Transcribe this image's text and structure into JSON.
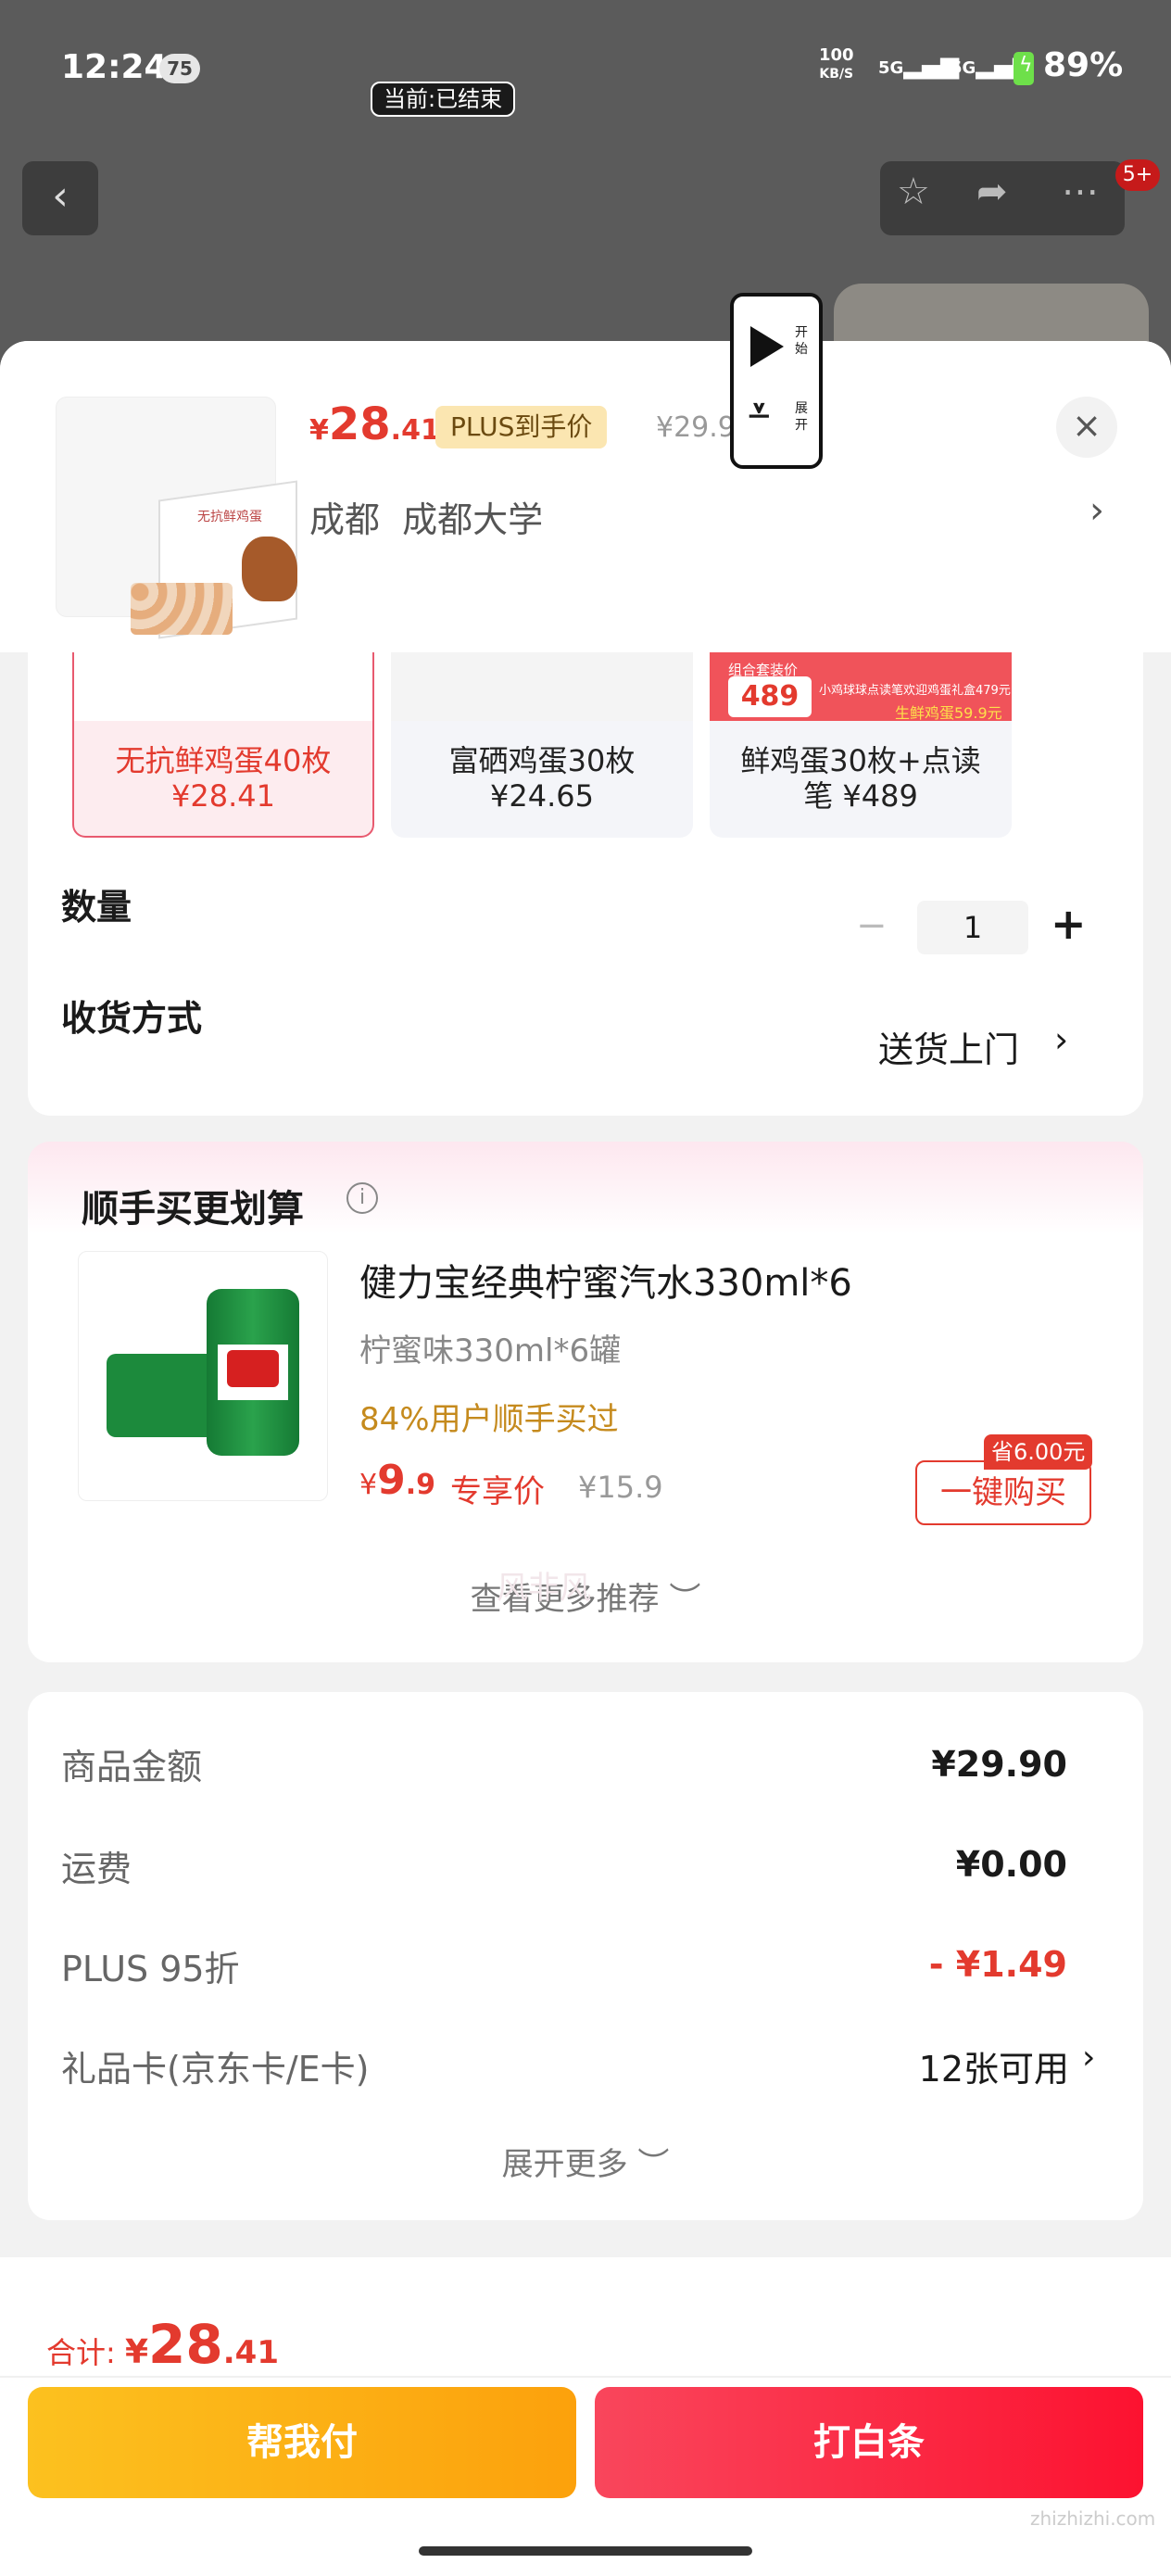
{
  "status_bar": {
    "time": "12:24",
    "notif_count": "75",
    "net_speed": "100",
    "net_unit": "KB/S",
    "signal1": "5G",
    "signal2": "5G",
    "battery": "89%"
  },
  "recording": {
    "label": "当前:已结束"
  },
  "top_nav": {
    "msg_badge": "5+"
  },
  "product": {
    "price_currency": "¥",
    "price_int": "28",
    "price_dec": ".41",
    "plus_tag": "PLUS到手价",
    "orig_price": "¥29.9",
    "thumb_title": "无抗鲜鸡蛋",
    "address": "成都  成都大学"
  },
  "floating_control": {
    "start_label": "开始",
    "collapse_label": "展开"
  },
  "spec_options": [
    {
      "label": "无抗鲜鸡蛋40枚\n¥28.41",
      "selected": true
    },
    {
      "label": "富硒鸡蛋30枚\n¥24.65",
      "selected": false
    },
    {
      "label": "鲜鸡蛋30枚+点读\n笔 ¥489",
      "selected": false,
      "promo_price": "489",
      "promo_line1": "组合套装价",
      "promo_line2": "生鲜鸡蛋59.9元",
      "promo_line3": "小鸡球球点读笔欢迎鸡蛋礼盒479元"
    }
  ],
  "quantity": {
    "label": "数量",
    "minus": "−",
    "value": "1",
    "plus": "+"
  },
  "delivery": {
    "label": "收货方式",
    "value": "送货上门"
  },
  "addon": {
    "title": "顺手买更划算",
    "name": "健力宝经典柠蜜汽水330ml*6",
    "spec": "柠蜜味330ml*6罐",
    "percent_text": "84%用户顺手买过",
    "price_currency": "¥",
    "price_int": "9",
    "price_dec": ".9",
    "exclusive": "专享价",
    "orig_price": "¥15.9",
    "save_tag": "省6.00元",
    "buy_label": "一键购买",
    "more_label": "查看更多推荐 ︶",
    "watermark": "风非风"
  },
  "summary": {
    "rows": [
      {
        "label": "商品金额",
        "value": "¥29.90"
      },
      {
        "label": "运费",
        "value": "¥0.00"
      },
      {
        "label": "PLUS 95折",
        "value": "- ¥1.49"
      },
      {
        "label": "礼品卡(京东卡/E卡)",
        "value": "12张可用"
      }
    ],
    "expand_label": "展开更多 ︶"
  },
  "bottom_bar": {
    "total_label": "合计: ",
    "total_currency": "¥",
    "total_int": "28",
    "total_dec": ".41",
    "help_pay": "帮我付",
    "baitiao": "打白条"
  },
  "watermark": "zhizhizhi.com",
  "colors": {
    "accent": "#e33a2e",
    "plus_bg": "#fbe6b1",
    "help_pay": "#fcb116",
    "baitiao": "#fb2a45"
  }
}
